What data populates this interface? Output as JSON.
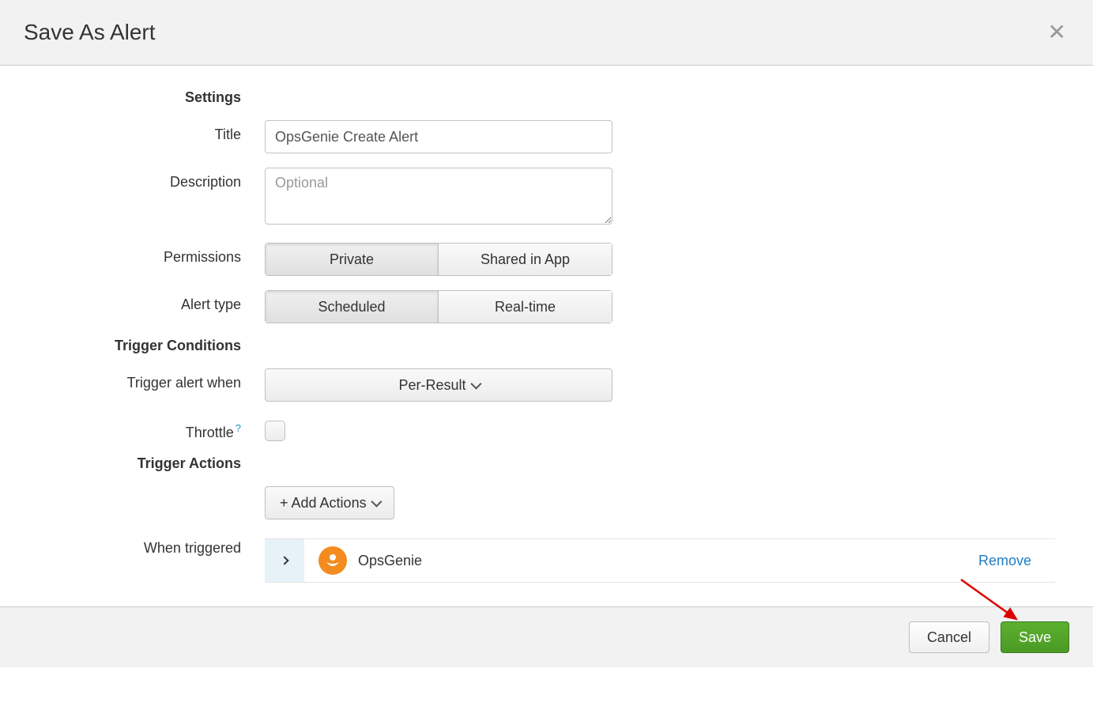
{
  "header": {
    "title": "Save As Alert"
  },
  "sections": {
    "settings": "Settings",
    "trigger_conditions": "Trigger Conditions",
    "trigger_actions": "Trigger Actions"
  },
  "labels": {
    "title": "Title",
    "description": "Description",
    "permissions": "Permissions",
    "alert_type": "Alert type",
    "trigger_when": "Trigger alert when",
    "throttle": "Throttle",
    "when_triggered": "When triggered"
  },
  "fields": {
    "title_value": "OpsGenie Create Alert",
    "description_placeholder": "Optional",
    "permissions_options": [
      "Private",
      "Shared in App"
    ],
    "permissions_selected": "Private",
    "alert_type_options": [
      "Scheduled",
      "Real-time"
    ],
    "alert_type_selected": "Scheduled",
    "trigger_when_value": "Per-Result",
    "throttle_checked": false,
    "add_actions_label": "+ Add Actions"
  },
  "actions": [
    {
      "name": "OpsGenie",
      "remove_label": "Remove"
    }
  ],
  "footer": {
    "cancel": "Cancel",
    "save": "Save"
  }
}
